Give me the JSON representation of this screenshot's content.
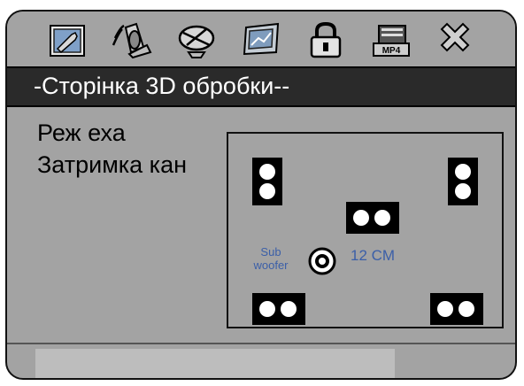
{
  "title": "-Сторінка 3D обробки--",
  "menu": {
    "item1": "Реж еха",
    "item2": "Затримка кан"
  },
  "icons": [
    "settings-wrench-icon",
    "audio-speaker-icon",
    "satellite-dish-icon",
    "picture-adjust-icon",
    "padlock-icon",
    "mp4-icon",
    "close-x-icon"
  ],
  "speaker_layout": {
    "subwoofer_label_line1": "Sub",
    "subwoofer_label_line2": "woofer",
    "delay_value": "12 CM"
  },
  "status": {
    "text": ""
  }
}
